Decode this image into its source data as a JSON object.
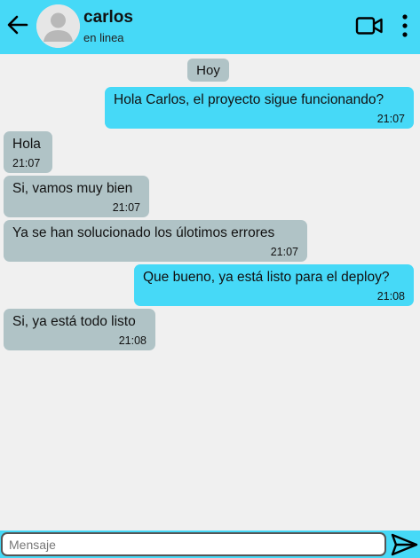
{
  "header": {
    "contact_name": "carlos",
    "contact_status": "en linea",
    "icons": [
      "back-arrow-icon",
      "avatar-icon",
      "video-call-icon",
      "more-vert-icon"
    ],
    "accent_color": "#46d9f7"
  },
  "chat": {
    "date_label": "Hoy",
    "messages": [
      {
        "direction": "out",
        "text": "Hola Carlos, el proyecto sigue funcionando?",
        "time": "21:07"
      },
      {
        "direction": "in",
        "text": "Hola",
        "time": "21:07"
      },
      {
        "direction": "in",
        "text": "Si, vamos muy bien",
        "time": "21:07"
      },
      {
        "direction": "in",
        "text": "Ya se han solucionado los úlotimos errores",
        "time": "21:07"
      },
      {
        "direction": "out",
        "text": "Que bueno, ya está listo para el deploy?",
        "time": "21:08"
      },
      {
        "direction": "in",
        "text": "Si, ya está todo listo",
        "time": "21:08"
      }
    ],
    "outgoing_color": "#46d9f7",
    "incoming_color": "#b0c3c6"
  },
  "composer": {
    "placeholder": "Mensaje",
    "value": "",
    "send_icon": "send-icon"
  }
}
